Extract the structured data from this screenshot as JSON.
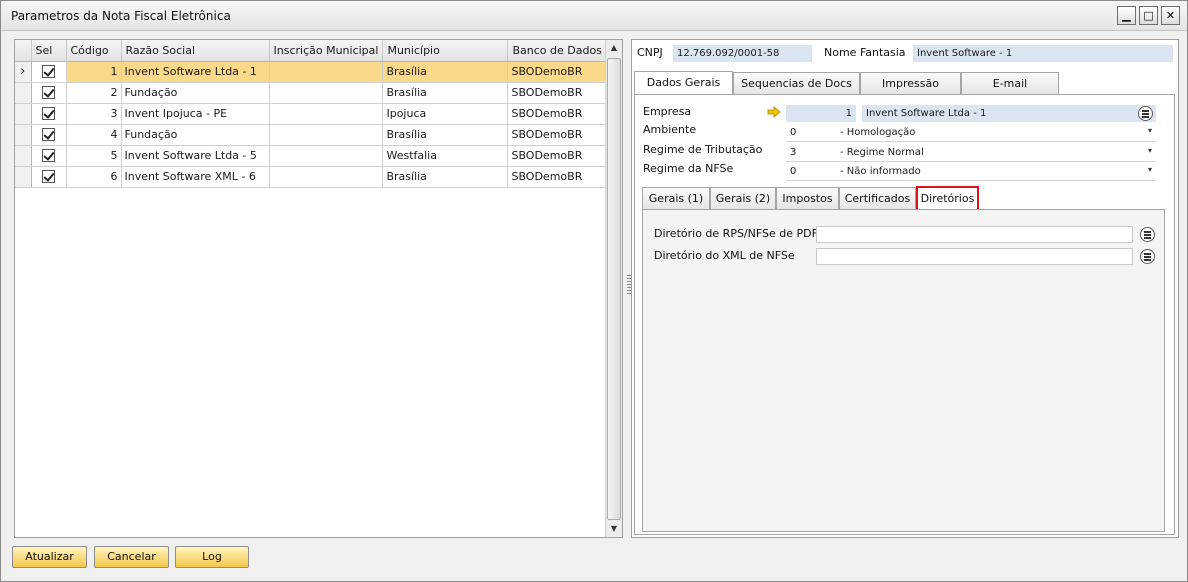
{
  "window": {
    "title": "Parametros da Nota Fiscal Eletrônica",
    "minimize_glyph": "▁",
    "maximize_glyph": "□",
    "close_glyph": "✕"
  },
  "grid": {
    "columns": [
      "Sel",
      "Código",
      "Razão Social",
      "Inscrição Municipal",
      "Município",
      "Banco de Dados"
    ],
    "selected_row_indicator": "›",
    "rows": [
      {
        "sel": true,
        "codigo": "1",
        "razao_social": "Invent Software Ltda - 1",
        "inscricao": "",
        "municipio": "Brasília",
        "banco": "SBODemoBR"
      },
      {
        "sel": true,
        "codigo": "2",
        "razao_social": "Fundação",
        "inscricao": "",
        "municipio": "Brasília",
        "banco": "SBODemoBR"
      },
      {
        "sel": true,
        "codigo": "3",
        "razao_social": "Invent Ipojuca - PE",
        "inscricao": "",
        "municipio": "Ipojuca",
        "banco": "SBODemoBR"
      },
      {
        "sel": true,
        "codigo": "4",
        "razao_social": "Fundação",
        "inscricao": "",
        "municipio": "Brasília",
        "banco": "SBODemoBR"
      },
      {
        "sel": true,
        "codigo": "5",
        "razao_social": "Invent Software Ltda - 5",
        "inscricao": "",
        "municipio": "Westfalia",
        "banco": "SBODemoBR"
      },
      {
        "sel": true,
        "codigo": "6",
        "razao_social": "Invent Software XML - 6",
        "inscricao": "",
        "municipio": "Brasília",
        "banco": "SBODemoBR"
      }
    ],
    "scroll_up_glyph": "▲",
    "scroll_down_glyph": "▼"
  },
  "header": {
    "cnpj_label": "CNPJ",
    "cnpj_value": "12.769.092/0001-58",
    "nome_fantasia_label": "Nome Fantasia",
    "nome_fantasia_value": "Invent Software - 1"
  },
  "main_tabs": [
    "Dados Gerais",
    "Sequencias de Docs",
    "Impressão",
    "E-mail"
  ],
  "dados_gerais": {
    "empresa_label": "Empresa",
    "empresa_code": "1",
    "empresa_name": "Invent Software Ltda - 1",
    "ambiente_label": "Ambiente",
    "ambiente_code": "0",
    "ambiente_desc": "- Homologação",
    "regime_trib_label": "Regime de Tributação",
    "regime_trib_code": "3",
    "regime_trib_desc": "- Regime Normal",
    "regime_nfse_label": "Regime da NFSe",
    "regime_nfse_code": "0",
    "regime_nfse_desc": "- Não informado",
    "dropdown_glyph": "▾"
  },
  "sub_tabs": [
    "Gerais (1)",
    "Gerais (2)",
    "Impostos",
    "Certificados",
    "Diretórios"
  ],
  "diretorios": {
    "rps_pdf_label": "Diretório de RPS/NFSe de PDF",
    "rps_pdf_value": "",
    "xml_label": "Diretório do XML de NFSe",
    "xml_value": ""
  },
  "buttons": {
    "atualizar": "Atualizar",
    "cancelar": "Cancelar",
    "log": "Log"
  },
  "colors": {
    "selected_row": "#fbd98b",
    "active_subtab_outline": "#d9141c",
    "link_arrow": "#f5c400"
  }
}
